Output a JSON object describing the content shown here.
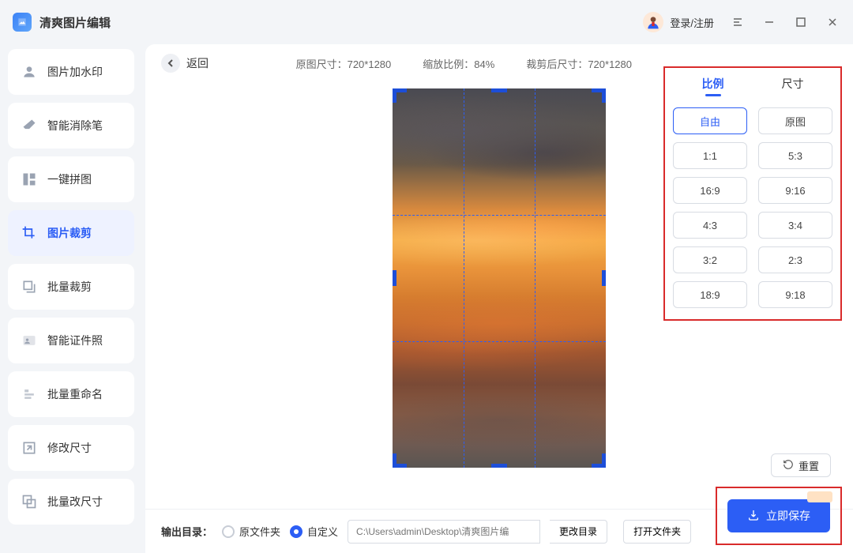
{
  "app": {
    "title": "清爽图片编辑"
  },
  "titlebar": {
    "login": "登录/注册"
  },
  "sidebar": {
    "items": [
      {
        "label": "图片加水印"
      },
      {
        "label": "智能消除笔"
      },
      {
        "label": "一键拼图"
      },
      {
        "label": "图片裁剪"
      },
      {
        "label": "批量裁剪"
      },
      {
        "label": "智能证件照"
      },
      {
        "label": "批量重命名"
      },
      {
        "label": "修改尺寸"
      },
      {
        "label": "批量改尺寸"
      }
    ]
  },
  "topbar": {
    "back": "返回",
    "orig_label": "原图尺寸：",
    "orig_value": "720*1280",
    "zoom_label": "缩放比例：",
    "zoom_value": "84%",
    "crop_label": "裁剪后尺寸：",
    "crop_value": "720*1280"
  },
  "panel": {
    "tab_ratio": "比例",
    "tab_size": "尺寸",
    "ratios": [
      "自由",
      "原图",
      "1:1",
      "5:3",
      "16:9",
      "9:16",
      "4:3",
      "3:4",
      "3:2",
      "2:3",
      "18:9",
      "9:18"
    ]
  },
  "actions": {
    "reset": "重置",
    "save": "立即保存"
  },
  "bottombar": {
    "label": "输出目录：",
    "opt_orig": "原文件夹",
    "opt_custom": "自定义",
    "path_placeholder": "C:\\Users\\admin\\Desktop\\清爽图片编",
    "change_dir": "更改目录",
    "open_dir": "打开文件夹"
  }
}
